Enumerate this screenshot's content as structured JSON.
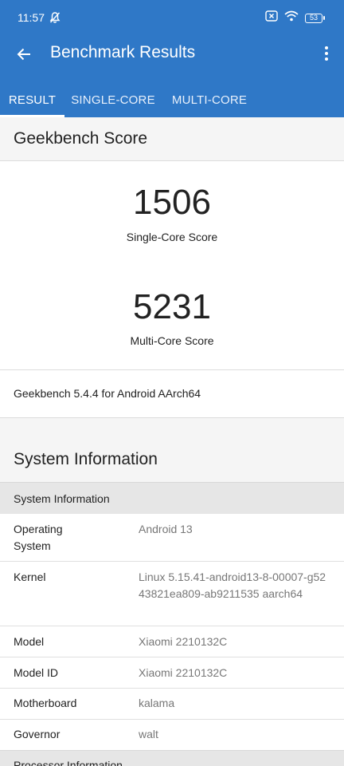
{
  "status_bar": {
    "time": "11:57",
    "battery": "53"
  },
  "app_bar": {
    "title": "Benchmark Results"
  },
  "tabs": [
    {
      "label": "RESULT"
    },
    {
      "label": "SINGLE-CORE"
    },
    {
      "label": "MULTI-CORE"
    }
  ],
  "score_section": {
    "title": "Geekbench Score",
    "single_value": "1506",
    "single_label": "Single-Core Score",
    "multi_value": "5231",
    "multi_label": "Multi-Core Score"
  },
  "version": "Geekbench 5.4.4 for Android AArch64",
  "system_section": {
    "title": "System Information",
    "subheader": "System Information",
    "rows": [
      {
        "key": "Operating System",
        "value": "Android 13"
      },
      {
        "key": "Kernel",
        "value": "Linux 5.15.41-android13-8-00007-g5243821ea809-ab9211535 aarch64"
      },
      {
        "key": "Model",
        "value": "Xiaomi 2210132C"
      },
      {
        "key": "Model ID",
        "value": "Xiaomi 2210132C"
      },
      {
        "key": "Motherboard",
        "value": "kalama"
      },
      {
        "key": "Governor",
        "value": "walt"
      }
    ],
    "next_subheader": "Processor Information"
  },
  "colors": {
    "app_bar": "#2f78c7",
    "section_bg": "#f5f5f5",
    "subheader_bg": "#e6e6e6",
    "value_text": "#777777"
  },
  "icons": [
    "mute-notification-icon",
    "sim-error-icon",
    "wifi-icon",
    "battery-icon",
    "back-arrow-icon",
    "more-vert-icon"
  ]
}
